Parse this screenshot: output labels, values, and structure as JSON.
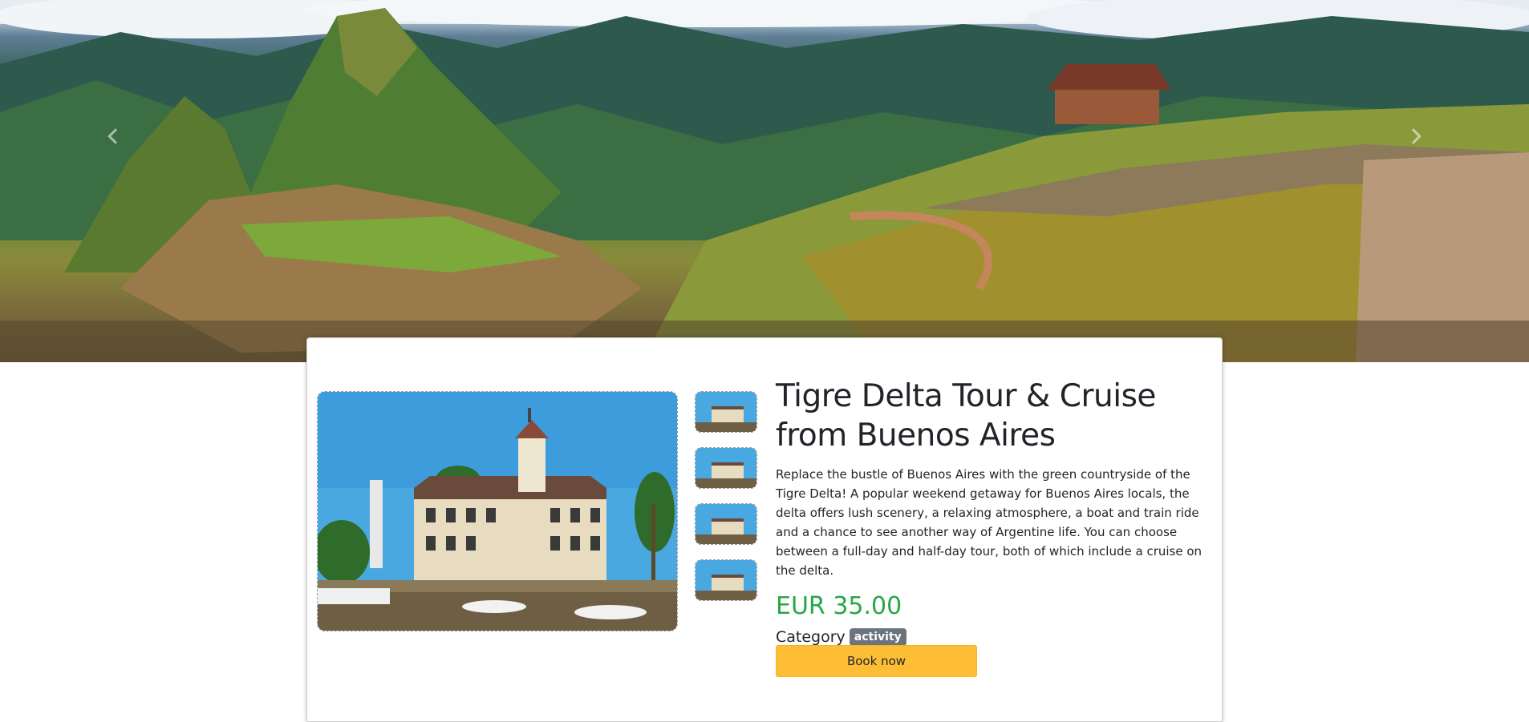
{
  "hero": {
    "image_name": "machu-picchu-panorama",
    "prev_icon": "chevron-left-icon",
    "next_icon": "chevron-right-icon"
  },
  "product": {
    "main_image_name": "tigre-delta-building-photo",
    "thumbnails": [
      "tigre-delta-thumb-1",
      "tigre-delta-thumb-2",
      "tigre-delta-thumb-3",
      "tigre-delta-thumb-4"
    ],
    "title": "Tigre Delta Tour & Cruise from Buenos Aires",
    "description": "Replace the bustle of Buenos Aires with the green countryside of the Tigre Delta! A popular weekend getaway for Buenos Aires locals, the delta offers lush scenery, a relaxing atmosphere, a boat and train ride and a chance to see another way of Argentine life. You can choose between a full-day and half-day tour, both of which include a cruise on the delta.",
    "price": "EUR 35.00",
    "category_label": "Category",
    "category_value": "activity",
    "book_label": "Book now"
  },
  "colors": {
    "price": "#28a745",
    "badge": "#6c757d",
    "button": "#fdbe36"
  }
}
